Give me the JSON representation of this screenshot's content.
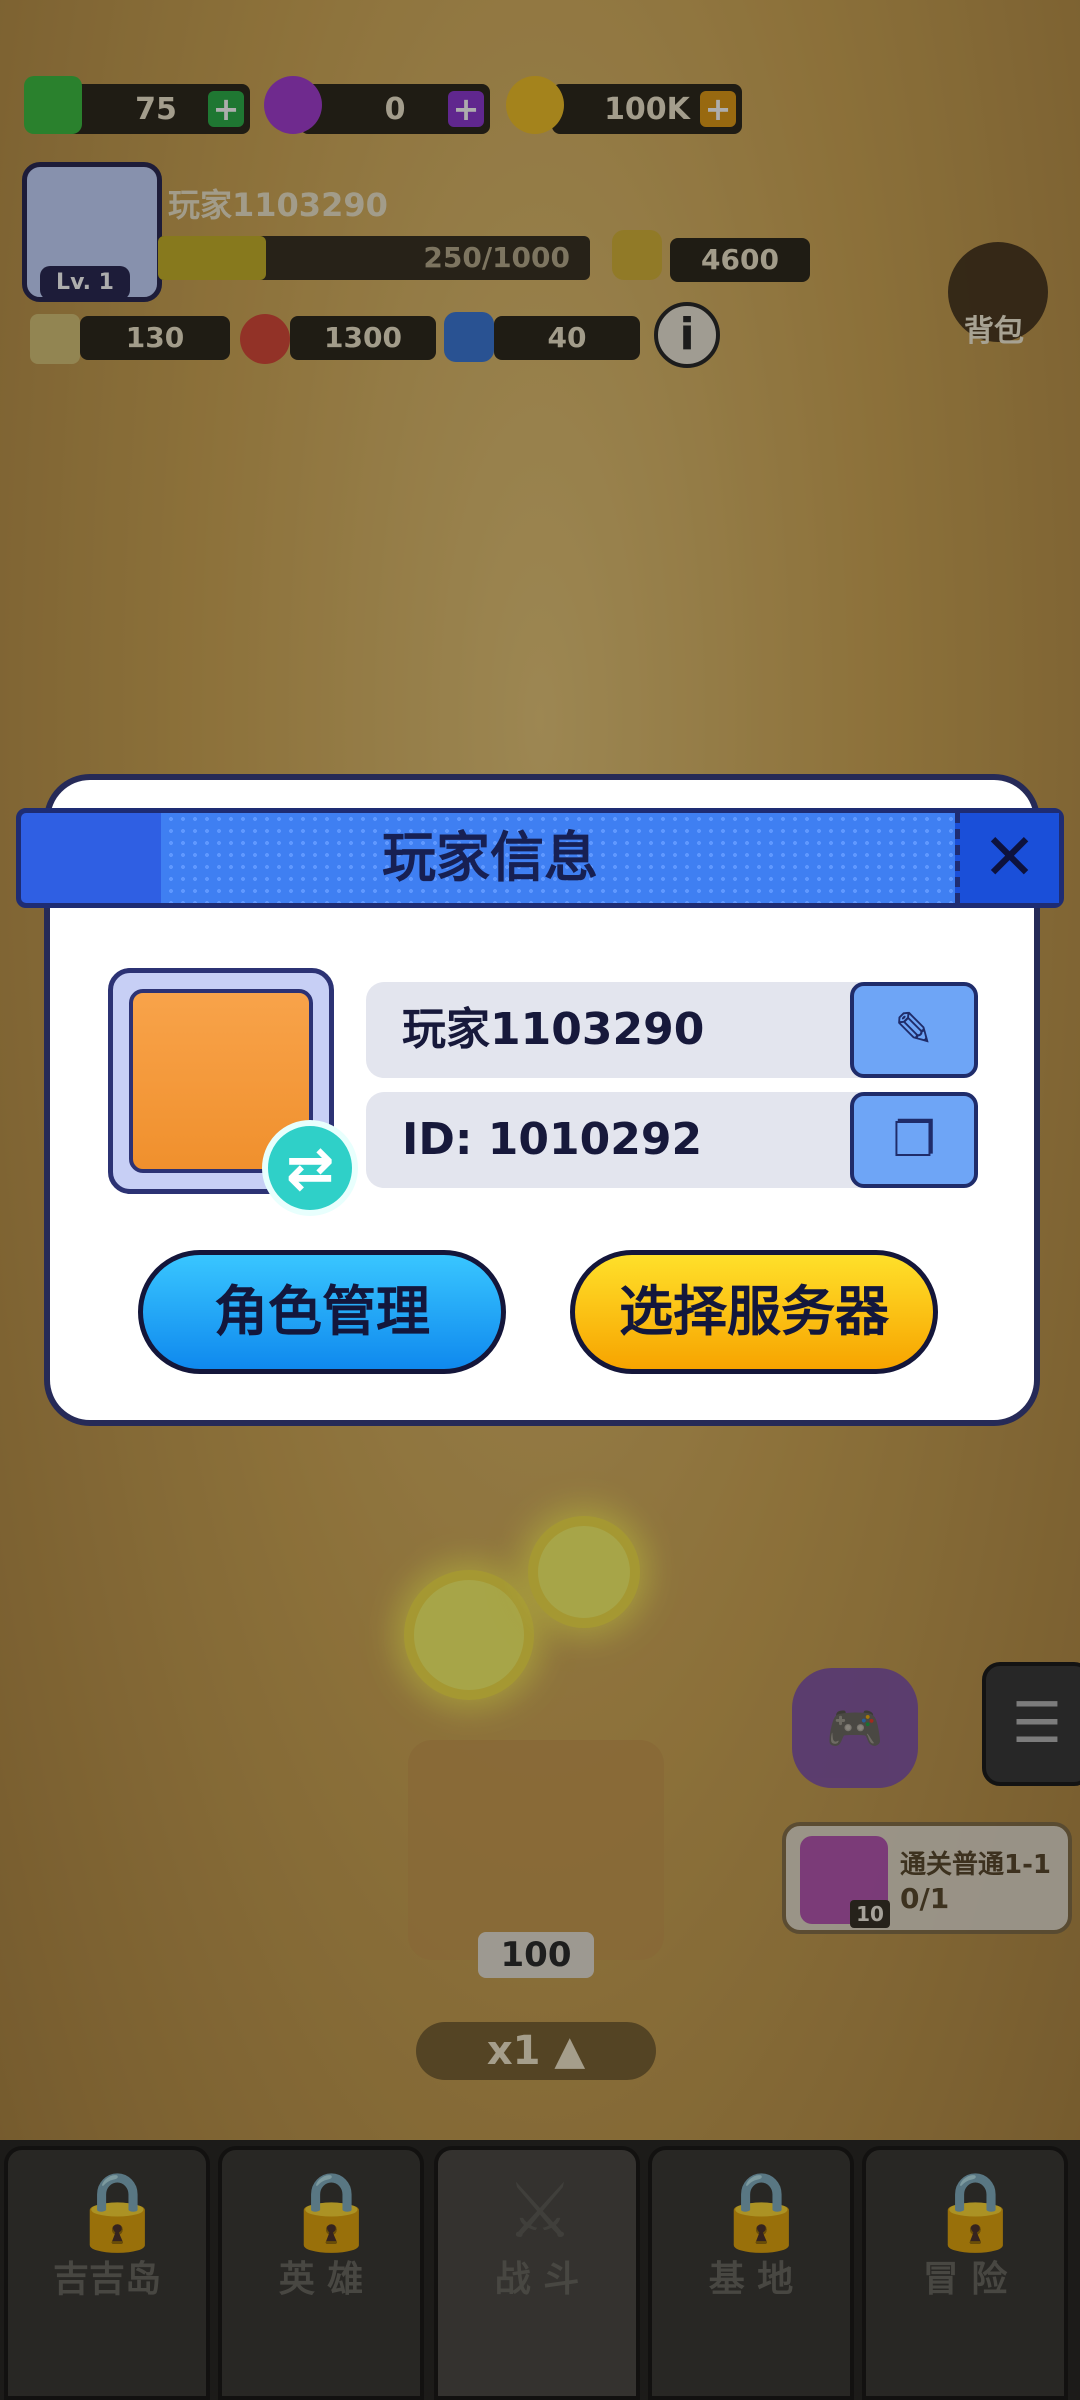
{
  "hud": {
    "energy": "75",
    "gems": "0",
    "coins": "100K",
    "player_name": "玩家1103290",
    "level": "Lv. 1",
    "xp_text": "250/1000",
    "xp_progress": 0.25,
    "power": "4600",
    "attack": "130",
    "health": "1300",
    "defense": "40",
    "bag_label": "背包"
  },
  "modal": {
    "title": "玩家信息",
    "player_name": "玩家1103290",
    "player_id": "ID: 1010292",
    "role_button": "角色管理",
    "server_button": "选择服务器"
  },
  "game": {
    "box_count": "100",
    "speed": "x1",
    "quest_title": "通关普通1-1",
    "quest_progress": "0/1",
    "quest_gem_count": "10"
  },
  "nav": {
    "items": [
      {
        "label": "吉吉岛"
      },
      {
        "label": "英 雄"
      },
      {
        "label": "战 斗"
      },
      {
        "label": "基 地"
      },
      {
        "label": "冒 险"
      }
    ]
  },
  "colors": {
    "header_blue": "#3f7ff2",
    "button_blue": "#1b9cf2",
    "button_yellow": "#ffc61a",
    "swap_teal": "#2fd0c8"
  }
}
